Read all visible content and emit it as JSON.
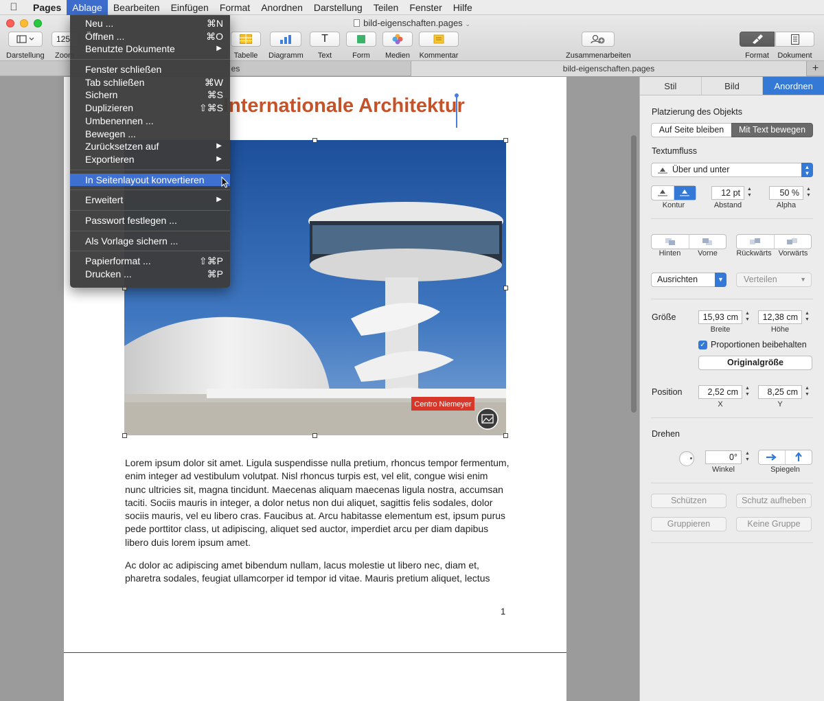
{
  "menubar": {
    "app": "Pages",
    "items": [
      "Ablage",
      "Bearbeiten",
      "Einfügen",
      "Format",
      "Anordnen",
      "Darstellung",
      "Teilen",
      "Fenster",
      "Hilfe"
    ]
  },
  "window": {
    "title": "bild-eigenschaften.pages",
    "tab_title": "bild-eigenschaften.pages",
    "tab_left_partial": "es"
  },
  "toolbar": {
    "darstellung": "Darstellung",
    "zoom_value": "125",
    "zoom": "Zoom",
    "tabelle": "Tabelle",
    "diagramm": "Diagramm",
    "text": "Text",
    "text_glyph": "T",
    "form": "Form",
    "medien": "Medien",
    "kommentar": "Kommentar",
    "zusammenarbeiten": "Zusammenarbeiten",
    "format": "Format",
    "dokument": "Dokument"
  },
  "ablage_menu": {
    "items": [
      {
        "label": "Neu ...",
        "shortcut": "⌘N"
      },
      {
        "label": "Öffnen ...",
        "shortcut": "⌘O"
      },
      {
        "label": "Benutzte Dokumente",
        "submenu": "▶"
      },
      {
        "label": "Fenster schließen"
      },
      {
        "label": "Tab schließen",
        "shortcut": "⌘W"
      },
      {
        "label": "Sichern",
        "shortcut": "⌘S"
      },
      {
        "label": "Duplizieren",
        "shortcut": "⇧⌘S"
      },
      {
        "label": "Umbenennen ..."
      },
      {
        "label": "Bewegen ..."
      },
      {
        "label": "Zurücksetzen auf",
        "submenu": "▶"
      },
      {
        "label": "Exportieren",
        "submenu": "▶"
      },
      {
        "label": "In Seitenlayout konvertieren"
      },
      {
        "label": "Erweitert",
        "submenu": "▶"
      },
      {
        "label": "Passwort festlegen ..."
      },
      {
        "label": "Als Vorlage sichern ..."
      },
      {
        "label": "Papierformat ...",
        "shortcut": "⇧⌘P"
      },
      {
        "label": "Drucken ...",
        "shortcut": "⌘P"
      }
    ]
  },
  "document": {
    "heading": "Internationale Architektur",
    "image_caption": "Centro Niemeyer",
    "paragraphs": [
      "Lorem ipsum dolor sit amet. Ligula suspendisse nulla pretium, rhoncus tempor fermentum, enim integer ad vestibulum volutpat. Nisl rhoncus turpis est, vel elit, congue wisi enim nunc ultricies sit, magna tincidunt. Maecenas aliquam maecenas ligula nostra, accumsan taciti. Sociis mauris in integer, a dolor netus non dui aliquet, sagittis felis sodales, dolor sociis mauris, vel eu libero cras. Faucibus at. Arcu habitasse elementum est, ipsum purus pede porttitor class, ut adipiscing, aliquet sed auctor, imperdiet arcu per diam dapibus libero duis lorem ipsum amet.",
      "Ac dolor ac adipiscing amet bibendum nullam, lacus molestie ut libero nec, diam et, pharetra sodales, feugiat ullamcorper id tempor id vitae. Mauris pretium aliquet, lectus"
    ],
    "page_number": "1"
  },
  "inspector": {
    "tabs": [
      "Stil",
      "Bild",
      "Anordnen"
    ],
    "placement_title": "Platzierung des Objekts",
    "placement_options": [
      "Auf Seite bleiben",
      "Mit Text bewegen"
    ],
    "textflow_title": "Textumfluss",
    "textflow_value": "Über und unter",
    "kontur": "Kontur",
    "abstand_value": "12 pt",
    "abstand": "Abstand",
    "alpha_value": "50 %",
    "alpha": "Alpha",
    "hinten": "Hinten",
    "vorne": "Vorne",
    "rueckwaerts": "Rückwärts",
    "vorwaerts": "Vorwärts",
    "ausrichten": "Ausrichten",
    "verteilen": "Verteilen",
    "groesse": "Größe",
    "breite_value": "15,93 cm",
    "breite": "Breite",
    "hoehe_value": "12,38 cm",
    "hoehe": "Höhe",
    "proportionen": "Proportionen beibehalten",
    "originalgroesse": "Originalgröße",
    "position": "Position",
    "x_value": "2,52 cm",
    "x": "X",
    "y_value": "8,25 cm",
    "y": "Y",
    "drehen": "Drehen",
    "winkel_value": "0°",
    "winkel": "Winkel",
    "spiegeln": "Spiegeln",
    "schuetzen": "Schützen",
    "schutz_aufheben": "Schutz aufheben",
    "gruppieren": "Gruppieren",
    "keine_gruppe": "Keine Gruppe"
  },
  "colors": {
    "accent": "#3479d6",
    "heading": "#c4532a",
    "menu_highlight": "#3e70d1"
  }
}
